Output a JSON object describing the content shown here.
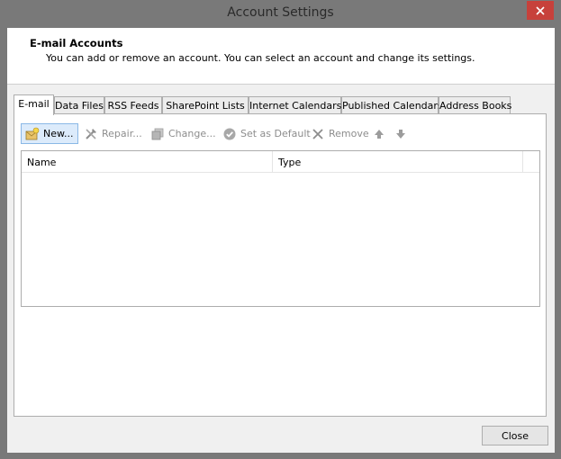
{
  "window": {
    "title": "Account Settings"
  },
  "header": {
    "title": "E-mail Accounts",
    "description": "You can add or remove an account. You can select an account and change its settings."
  },
  "tabs": [
    {
      "label": "E-mail",
      "active": true
    },
    {
      "label": "Data Files",
      "active": false
    },
    {
      "label": "RSS Feeds",
      "active": false
    },
    {
      "label": "SharePoint Lists",
      "active": false
    },
    {
      "label": "Internet Calendars",
      "active": false
    },
    {
      "label": "Published Calendars",
      "active": false
    },
    {
      "label": "Address Books",
      "active": false
    }
  ],
  "toolbar": {
    "new_label": "New...",
    "repair_label": "Repair...",
    "change_label": "Change...",
    "default_label": "Set as Default",
    "remove_label": "Remove",
    "icons": [
      "new-account-icon",
      "repair-icon",
      "change-icon",
      "set-default-icon",
      "remove-icon",
      "move-up-icon",
      "move-down-icon"
    ]
  },
  "list": {
    "columns": [
      "Name",
      "Type"
    ],
    "rows": []
  },
  "footer": {
    "close_label": "Close"
  },
  "colors": {
    "frame": "#797979",
    "close_x": "#c7413b",
    "selected_button": "#dcebfb",
    "selected_button_border": "#8ab8e6",
    "disabled_text": "#8d8d8d"
  }
}
